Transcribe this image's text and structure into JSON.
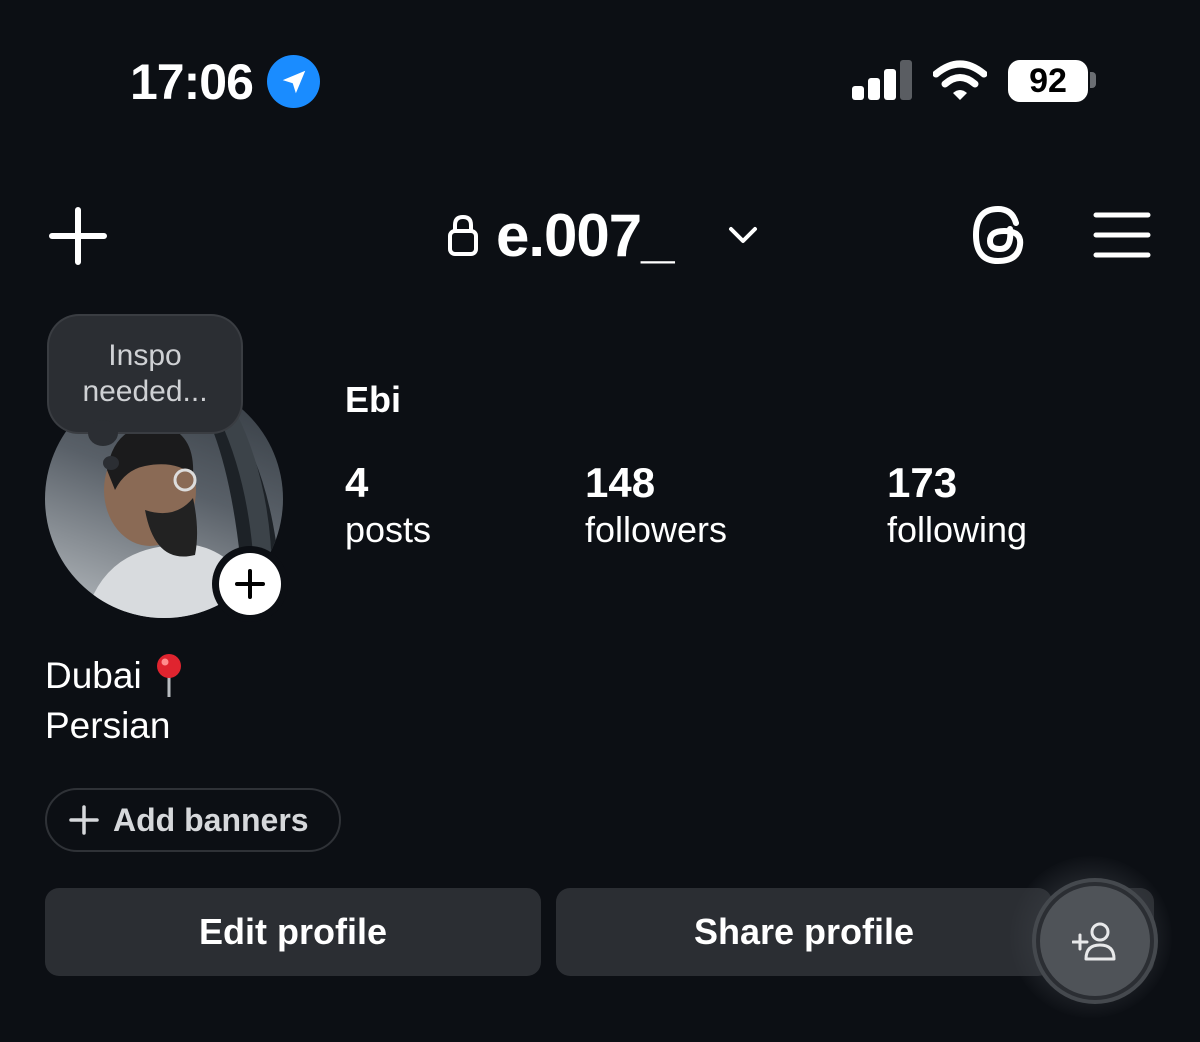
{
  "status_bar": {
    "time": "17:06",
    "battery": "92",
    "location_icon": "location-arrow-icon",
    "signal_icon": "cellular-signal-icon",
    "wifi_icon": "wifi-icon"
  },
  "header": {
    "username": "e.007_",
    "create_icon": "plus-icon",
    "lock_icon": "lock-icon",
    "switch_icon": "chevron-down-icon",
    "threads_icon": "threads-icon",
    "menu_icon": "hamburger-menu-icon"
  },
  "note": {
    "line1": "Inspo",
    "line2": "needed..."
  },
  "profile": {
    "name": "Ebi",
    "stats": {
      "posts_count": "4",
      "posts_label": "posts",
      "followers_count": "148",
      "followers_label": "followers",
      "following_count": "173",
      "following_label": "following"
    },
    "bio": {
      "line1": "Dubai",
      "line1_emoji": "round-pushpin-icon",
      "line2": "Persian"
    }
  },
  "banners": {
    "label": "Add banners"
  },
  "actions": {
    "edit_label": "Edit profile",
    "share_label": "Share profile",
    "add_user_icon": "add-person-icon"
  },
  "colors": {
    "background": "#0c0f14",
    "button": "#2b2e33",
    "accent_blue": "#1a8cff"
  }
}
